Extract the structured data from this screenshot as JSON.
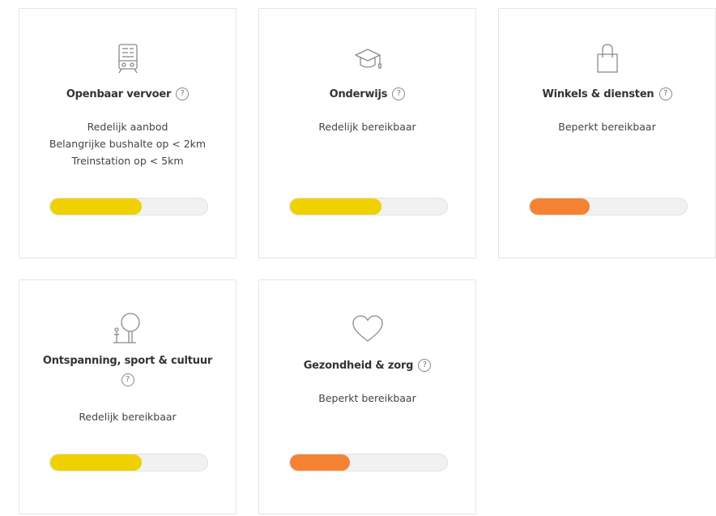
{
  "help_symbol": "?",
  "colors": {
    "yellow": "#f0d100",
    "orange": "#f58232",
    "icon_stroke": "#8a8a8a",
    "card_border": "#e6e6e6",
    "track": "#f1f1f1"
  },
  "cards": [
    {
      "icon": "train-icon",
      "title": "Openbaar vervoer",
      "lines": [
        "Redelijk aanbod",
        "Belangrijke bushalte op < 2km",
        "Treinstation op < 5km"
      ],
      "level": 0.58,
      "color": "#f0d100"
    },
    {
      "icon": "graduation-cap-icon",
      "title": "Onderwijs",
      "lines": [
        "Redelijk bereikbaar"
      ],
      "level": 0.58,
      "color": "#f0d100"
    },
    {
      "icon": "shopping-bag-icon",
      "title": "Winkels & diensten",
      "lines": [
        "Beperkt bereikbaar"
      ],
      "level": 0.38,
      "color": "#f58232"
    },
    {
      "icon": "tree-person-icon",
      "title": "Ontspanning, sport & cultuur",
      "lines": [
        "Redelijk bereikbaar"
      ],
      "level": 0.58,
      "color": "#f0d100"
    },
    {
      "icon": "heart-icon",
      "title": "Gezondheid & zorg",
      "lines": [
        "Beperkt bereikbaar"
      ],
      "level": 0.38,
      "color": "#f58232"
    }
  ]
}
